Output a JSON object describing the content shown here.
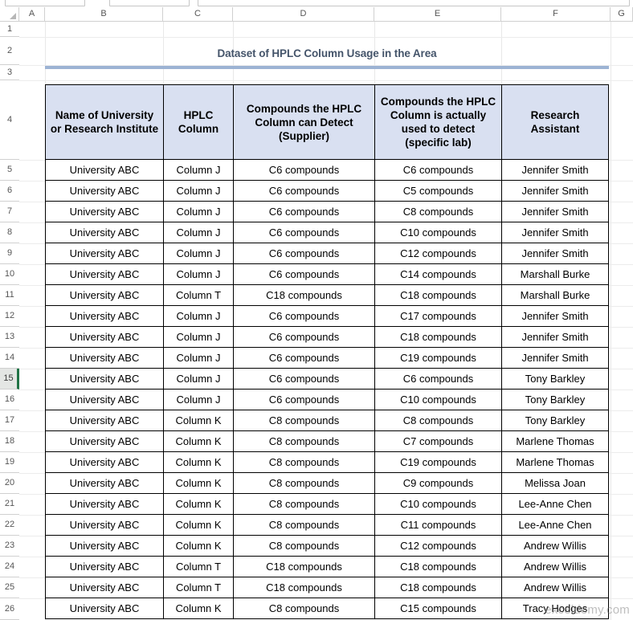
{
  "app": {
    "kind": "spreadsheet",
    "accent_green": "#217346",
    "header_fill": "#D9E0F1",
    "title_color": "#44546A",
    "rule_color": "#9CB3D4"
  },
  "formula_bar": {
    "name_box_value": "",
    "fx_label": "",
    "formula_value": ""
  },
  "grid": {
    "column_headers": [
      "A",
      "B",
      "C",
      "D",
      "E",
      "F",
      "G"
    ],
    "row_headers": [
      "1",
      "2",
      "3",
      "4",
      "5",
      "6",
      "7",
      "8",
      "9",
      "10",
      "11",
      "12",
      "13",
      "14",
      "15",
      "16",
      "17",
      "18",
      "19",
      "20",
      "21",
      "22",
      "23",
      "24",
      "25",
      "26"
    ],
    "active_row": "15",
    "select_all_icon": "select-all-triangle"
  },
  "sheet": {
    "title": "Dataset of HPLC Column Usage in the Area"
  },
  "table": {
    "headers": [
      "Name of University or Research Institute",
      "HPLC Column",
      "Compounds the HPLC Column can Detect (Supplier)",
      "Compounds the HPLC Column is actually used to detect (specific lab)",
      "Research Assistant"
    ],
    "rows": [
      [
        "University ABC",
        "Column J",
        "C6 compounds",
        "C6 compounds",
        "Jennifer Smith"
      ],
      [
        "University ABC",
        "Column J",
        "C6 compounds",
        "C5 compounds",
        "Jennifer Smith"
      ],
      [
        "University ABC",
        "Column J",
        "C6 compounds",
        "C8 compounds",
        "Jennifer Smith"
      ],
      [
        "University ABC",
        "Column J",
        "C6 compounds",
        "C10 compounds",
        "Jennifer Smith"
      ],
      [
        "University ABC",
        "Column J",
        "C6 compounds",
        "C12 compounds",
        "Jennifer Smith"
      ],
      [
        "University ABC",
        "Column J",
        "C6 compounds",
        "C14 compounds",
        "Marshall Burke"
      ],
      [
        "University ABC",
        "Column T",
        "C18 compounds",
        "C18 compounds",
        "Marshall Burke"
      ],
      [
        "University ABC",
        "Column J",
        "C6 compounds",
        "C17 compounds",
        "Jennifer Smith"
      ],
      [
        "University ABC",
        "Column J",
        "C6 compounds",
        "C18 compounds",
        "Jennifer Smith"
      ],
      [
        "University ABC",
        "Column J",
        "C6 compounds",
        "C19 compounds",
        "Jennifer Smith"
      ],
      [
        "University ABC",
        "Column J",
        "C6 compounds",
        "C6 compounds",
        "Tony Barkley"
      ],
      [
        "University ABC",
        "Column J",
        "C6 compounds",
        "C10 compounds",
        "Tony Barkley"
      ],
      [
        "University ABC",
        "Column K",
        "C8 compounds",
        "C8 compounds",
        "Tony Barkley"
      ],
      [
        "University ABC",
        "Column K",
        "C8 compounds",
        "C7 compounds",
        "Marlene Thomas"
      ],
      [
        "University ABC",
        "Column K",
        "C8 compounds",
        "C19 compounds",
        "Marlene Thomas"
      ],
      [
        "University ABC",
        "Column K",
        "C8 compounds",
        "C9 compounds",
        "Melissa Joan"
      ],
      [
        "University ABC",
        "Column K",
        "C8 compounds",
        "C10 compounds",
        "Lee-Anne Chen"
      ],
      [
        "University ABC",
        "Column K",
        "C8 compounds",
        "C11 compounds",
        "Lee-Anne Chen"
      ],
      [
        "University ABC",
        "Column K",
        "C8 compounds",
        "C12 compounds",
        "Andrew Willis"
      ],
      [
        "University ABC",
        "Column T",
        "C18 compounds",
        "C18 compounds",
        "Andrew Willis"
      ],
      [
        "University ABC",
        "Column T",
        "C18 compounds",
        "C18 compounds",
        "Andrew Willis"
      ],
      [
        "University ABC",
        "Column K",
        "C8 compounds",
        "C15 compounds",
        "Tracy Hodges"
      ]
    ]
  },
  "watermark": {
    "text": "exceldemy.com"
  }
}
